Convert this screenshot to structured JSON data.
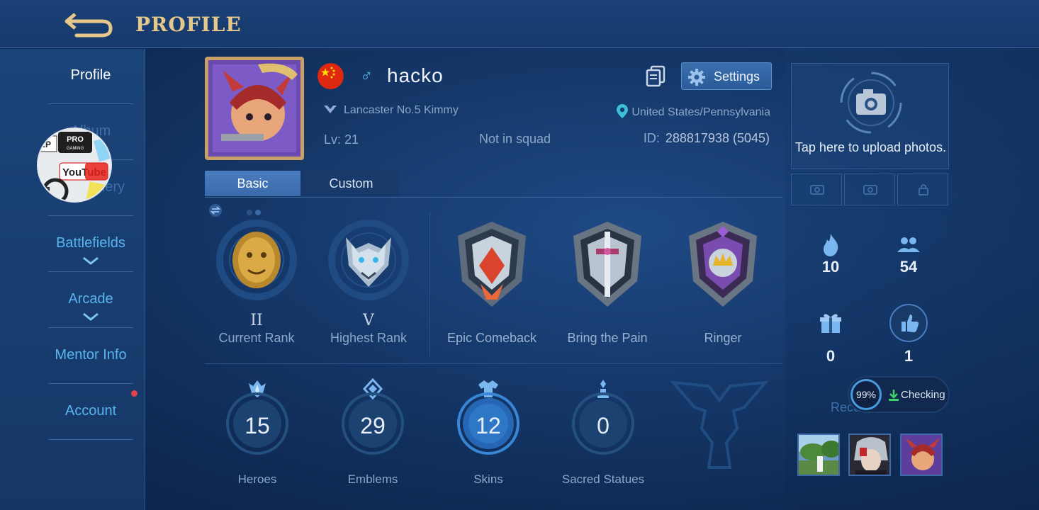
{
  "header": {
    "title": "PROFILE"
  },
  "sidebar": {
    "items": [
      {
        "label": "Profile"
      },
      {
        "label": "Album"
      },
      {
        "label": "Gallery"
      },
      {
        "label": "Battlefields"
      },
      {
        "label": "Arcade"
      },
      {
        "label": "Mentor Info"
      },
      {
        "label": "Account"
      }
    ],
    "sticker_texts": {
      "pro": "PRO",
      "gaming": "GAMING",
      "youtube": "YouTube",
      "ep": "EP"
    }
  },
  "profile": {
    "username": "hacko",
    "gender_symbol": "♂",
    "skin": "Lancaster No.5 Kimmy",
    "location": "United States/Pennsylvania",
    "level": "Lv: 21",
    "squad": "Not in squad",
    "id_label": "ID:",
    "id_value": "288817938 (5045)",
    "settings_label": "Settings"
  },
  "tabs": [
    {
      "label": "Basic"
    },
    {
      "label": "Custom"
    }
  ],
  "badges": [
    {
      "roman": "II",
      "label": "Current Rank"
    },
    {
      "roman": "V",
      "label": "Highest Rank"
    },
    {
      "roman": "",
      "label": "Epic Comeback"
    },
    {
      "roman": "",
      "label": "Bring the Pain"
    },
    {
      "roman": "",
      "label": "Ringer"
    }
  ],
  "stats": [
    {
      "value": "15",
      "label": "Heroes"
    },
    {
      "value": "29",
      "label": "Emblems"
    },
    {
      "value": "12",
      "label": "Skins"
    },
    {
      "value": "0",
      "label": "Sacred Statues"
    }
  ],
  "right": {
    "upload_text": "Tap here to upload photos.",
    "counters": [
      {
        "icon": "flame-icon",
        "value": "10"
      },
      {
        "icon": "friends-icon",
        "value": "54"
      },
      {
        "icon": "gift-icon",
        "value": "0"
      },
      {
        "icon": "thumbs-up-icon",
        "value": "1"
      }
    ],
    "recent_visits": "Recent Visits",
    "checking_pct": "99%",
    "checking_text": "Checking"
  },
  "colors": {
    "accent": "#5ab4ee",
    "title_gold": "#e6c98a",
    "bg": "#163a6d"
  }
}
